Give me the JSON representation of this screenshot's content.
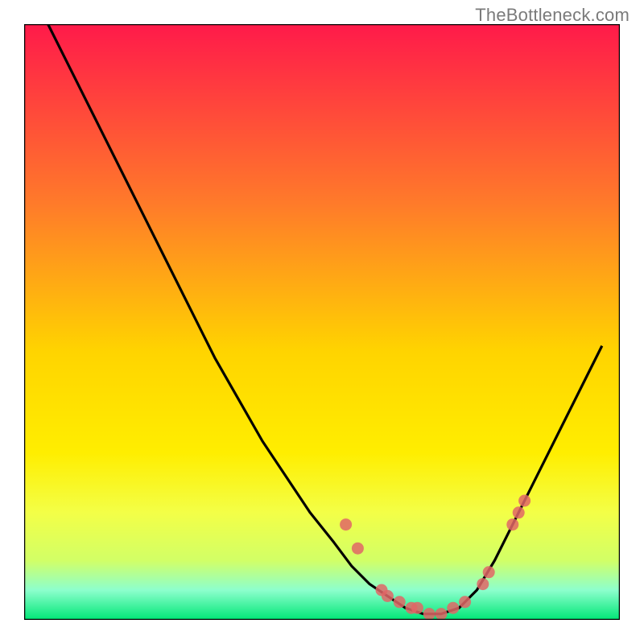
{
  "watermark": "TheBottleneck.com",
  "chart_data": {
    "type": "line",
    "title": "",
    "xlabel": "",
    "ylabel": "",
    "xlim": [
      0,
      100
    ],
    "ylim": [
      0,
      100
    ],
    "background_gradient": {
      "top": "#ff1a4a",
      "middle1": "#ff7a00",
      "middle2": "#ffe600",
      "bottom_zone": "#eaff66",
      "base": "#00e676"
    },
    "series": [
      {
        "name": "bottleneck-curve",
        "color": "#000000",
        "x": [
          4,
          8,
          12,
          16,
          20,
          24,
          28,
          32,
          36,
          40,
          44,
          48,
          52,
          55,
          58,
          61,
          64,
          67,
          70,
          73,
          76,
          79,
          82,
          85,
          88,
          91,
          94,
          97
        ],
        "y": [
          100,
          92,
          84,
          76,
          68,
          60,
          52,
          44,
          37,
          30,
          24,
          18,
          13,
          9,
          6,
          4,
          2,
          1,
          1,
          2,
          5,
          10,
          16,
          22,
          28,
          34,
          40,
          46
        ]
      }
    ],
    "markers": {
      "name": "sample-points",
      "color": "#e06666",
      "points": [
        {
          "x": 54,
          "y": 16
        },
        {
          "x": 56,
          "y": 12
        },
        {
          "x": 60,
          "y": 5
        },
        {
          "x": 61,
          "y": 4
        },
        {
          "x": 63,
          "y": 3
        },
        {
          "x": 65,
          "y": 2
        },
        {
          "x": 66,
          "y": 2
        },
        {
          "x": 68,
          "y": 1
        },
        {
          "x": 70,
          "y": 1
        },
        {
          "x": 72,
          "y": 2
        },
        {
          "x": 74,
          "y": 3
        },
        {
          "x": 77,
          "y": 6
        },
        {
          "x": 78,
          "y": 8
        },
        {
          "x": 82,
          "y": 16
        },
        {
          "x": 83,
          "y": 18
        },
        {
          "x": 84,
          "y": 20
        }
      ]
    }
  }
}
